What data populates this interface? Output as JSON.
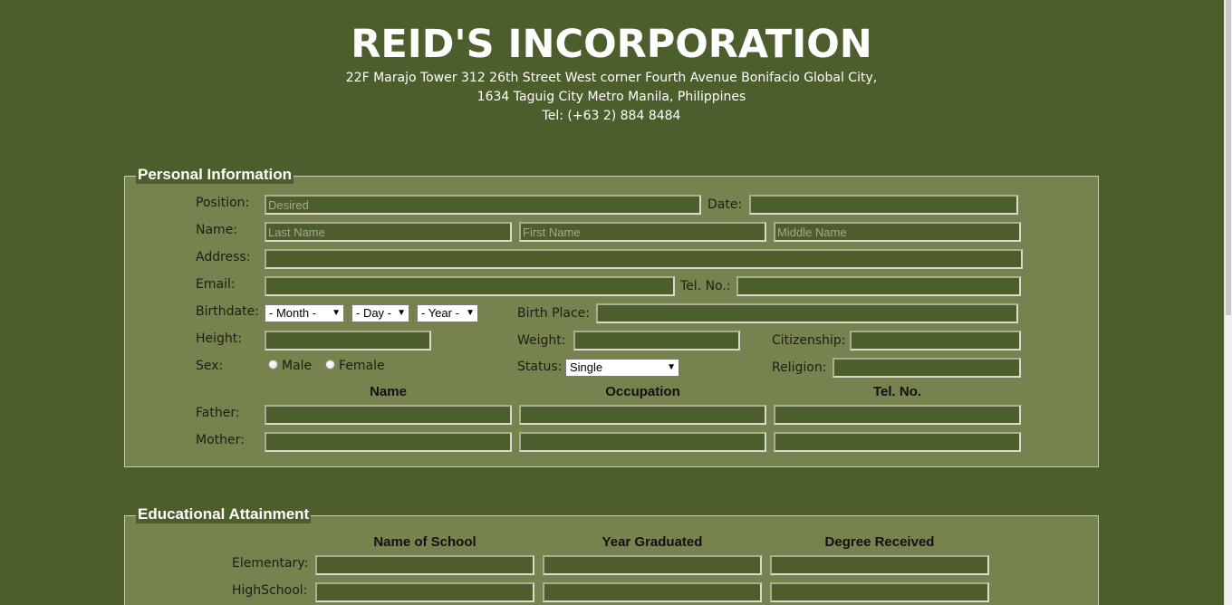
{
  "header": {
    "company": "REID'S INCORPORATION",
    "address_line1": "22F Marajo Tower 312 26th Street West corner Fourth Avenue Bonifacio Global City,",
    "address_line2": "1634 Taguig City Metro Manila, Philippines",
    "tel": "Tel: (+63 2) 884 8484"
  },
  "personal": {
    "legend": "Personal Information",
    "position_label": "Position:",
    "position_placeholder": "Desired",
    "date_label": "Date:",
    "name_label": "Name:",
    "last_name_placeholder": "Last Name",
    "first_name_placeholder": "First Name",
    "middle_name_placeholder": "Middle Name",
    "address_label": "Address:",
    "email_label": "Email:",
    "tel_label": "Tel. No.:",
    "birthdate_label": "Birthdate:",
    "month_select": "- Month -",
    "day_select": "- Day -",
    "year_select": "- Year -",
    "birthplace_label": "Birth Place:",
    "height_label": "Height:",
    "weight_label": "Weight:",
    "citizenship_label": "Citizenship:",
    "sex_label": "Sex:",
    "male_label": "Male",
    "female_label": "Female",
    "status_label": "Status:",
    "status_select": "Single",
    "religion_label": "Religion:",
    "parents_columns": [
      "Name",
      "Occupation",
      "Tel. No."
    ],
    "father_label": "Father:",
    "mother_label": "Mother:"
  },
  "education": {
    "legend": "Educational Attainment",
    "columns": [
      "Name of School",
      "Year Graduated",
      "Degree Received"
    ],
    "elementary_label": "Elementary:",
    "highschool_label": "HighSchool:"
  },
  "icons": {
    "select_arrow": "chevron-down-icon"
  },
  "colors": {
    "background": "#4d5e2d",
    "panel": "#77834f",
    "input_bg": "#4d5e2d"
  }
}
